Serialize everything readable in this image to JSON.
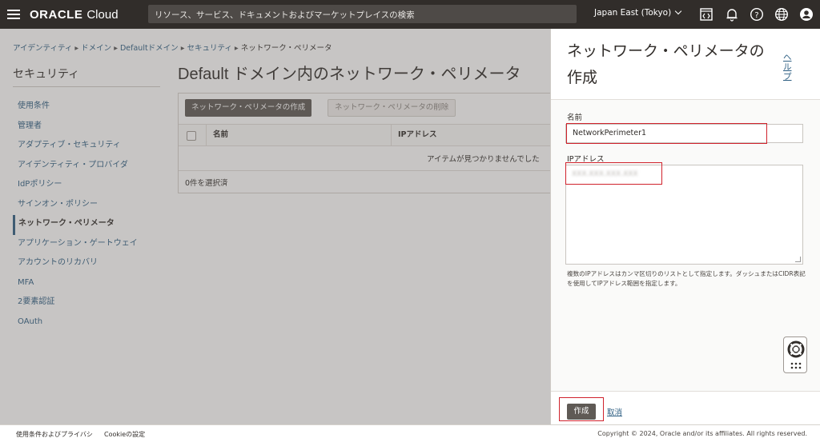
{
  "topbar": {
    "brand": "ORACLE",
    "product": "Cloud",
    "search_placeholder": "リソース、サービス、ドキュメントおよびマーケットプレイスの検索",
    "region": "Japan East (Tokyo)",
    "icons": [
      "hamburger-icon",
      "code-editor-icon",
      "bell-icon",
      "help-icon",
      "globe-icon",
      "user-icon"
    ]
  },
  "breadcrumb": {
    "items": [
      "アイデンティティ",
      "ドメイン",
      "Defaultドメイン",
      "セキュリティ"
    ],
    "current": "ネットワーク・ペリメータ"
  },
  "sidebar": {
    "title": "セキュリティ",
    "items": [
      {
        "label": "使用条件"
      },
      {
        "label": "管理者"
      },
      {
        "label": "アダプティブ・セキュリティ"
      },
      {
        "label": "アイデンティティ・プロバイダ"
      },
      {
        "label": "IdPポリシー"
      },
      {
        "label": "サインオン・ポリシー"
      },
      {
        "label": "ネットワーク・ペリメータ",
        "active": true
      },
      {
        "label": "アプリケーション・ゲートウェイ"
      },
      {
        "label": "アカウントのリカバリ"
      },
      {
        "label": "MFA"
      },
      {
        "label": "2要素認証"
      },
      {
        "label": "OAuth"
      }
    ]
  },
  "main": {
    "title": "Default ドメイン内のネットワーク・ペリメータ",
    "create_button": "ネットワーク・ペリメータの作成",
    "delete_button": "ネットワーク・ペリメータの削除",
    "columns": [
      "名前",
      "IPアドレス"
    ],
    "empty_message": "アイテムが見つかりませんでした",
    "selected_count": "0件を選択済"
  },
  "drawer": {
    "title": "ネットワーク・ペリメータの作成",
    "help_link": "ヘルプ",
    "name_label": "名前",
    "name_value": "NetworkPerimeter1",
    "ip_label": "IPアドレス",
    "ip_value": "XXX.XXX.XXX.XXX",
    "hint": "複数のIPアドレスはカンマ区切りのリストとして指定します。ダッシュまたはCIDR表記を使用してIPアドレス範囲を指定します。",
    "create_button": "作成",
    "cancel_link": "取消"
  },
  "footer": {
    "terms": "使用条件およびプライバシ",
    "cookies": "Cookieの設定",
    "copyright": "Copyright © 2024, Oracle and/or its affiliates. All rights reserved."
  },
  "colors": {
    "topbar": "#312d2a",
    "link": "#2e5f83",
    "primary_button": "#5f5a55",
    "highlight": "#d0222c"
  }
}
